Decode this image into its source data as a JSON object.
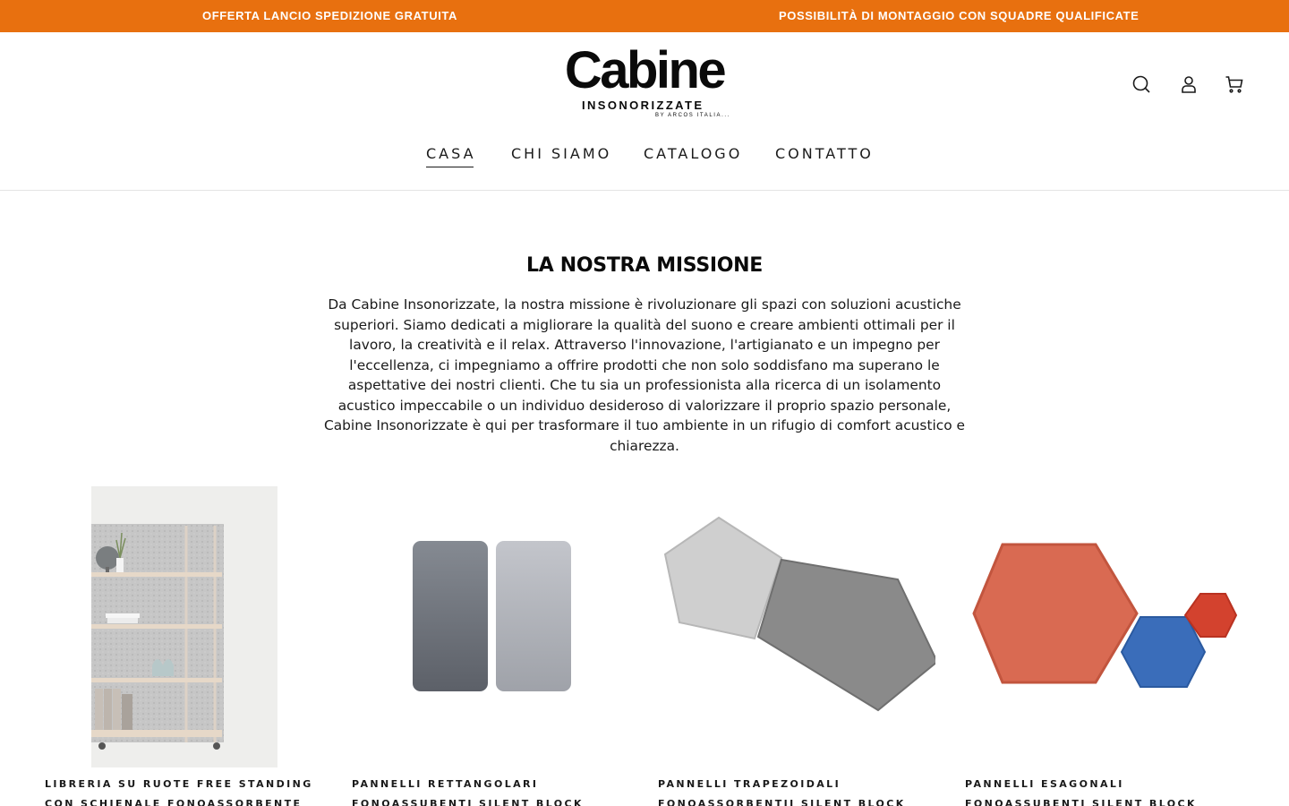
{
  "announcement": {
    "left": "OFFERTA LANCIO SPEDIZIONE GRATUITA",
    "right": "POSSIBILITÀ DI MONTAGGIO CON SQUADRE QUALIFICATE",
    "background": "#e8700f"
  },
  "header": {
    "logo": {
      "word": "Cabine",
      "sub": "INSONORIZZATE",
      "by": "BY ARCOS ITALIA..."
    },
    "icons": [
      "search-icon",
      "account-icon",
      "cart-icon"
    ],
    "nav": [
      {
        "label": "CASA",
        "active": true
      },
      {
        "label": "CHI SIAMO"
      },
      {
        "label": "CATALOGO"
      },
      {
        "label": "CONTATTO"
      }
    ]
  },
  "mission": {
    "title": "LA NOSTRA MISSIONE",
    "text": "Da Cabine Insonorizzate, la nostra missione è rivoluzionare gli spazi con soluzioni acustiche superiori. Siamo dedicati a migliorare la qualità del suono e creare ambienti ottimali per il lavoro, la creatività e il relax. Attraverso l'innovazione, l'artigianato e un impegno per l'eccellenza, ci impegniamo a offrire prodotti che non solo soddisfano ma superano le aspettative dei nostri clienti. Che tu sia un professionista alla ricerca di un isolamento acustico impeccabile o un individuo desideroso di valorizzare il proprio spazio personale, Cabine Insonorizzate è qui per trasformare il tuo ambiente in un rifugio di comfort acustico e chiarezza."
  },
  "products": [
    {
      "title": "LIBRERIA SU RUOTE FREE STANDING CON SCHIENALE FONOASSORBENTE TANCA"
    },
    {
      "title": "PANNELLI RETTANGOLARI FONOASSUBENTI SILENT BLOCK"
    },
    {
      "title": "PANNELLI TRAPEZOIDALI FONOASSORBENTII SILENT BLOCK"
    },
    {
      "title": "PANNELLI ESAGONALI FONOASSUBENTI SILENT BLOCK"
    }
  ]
}
